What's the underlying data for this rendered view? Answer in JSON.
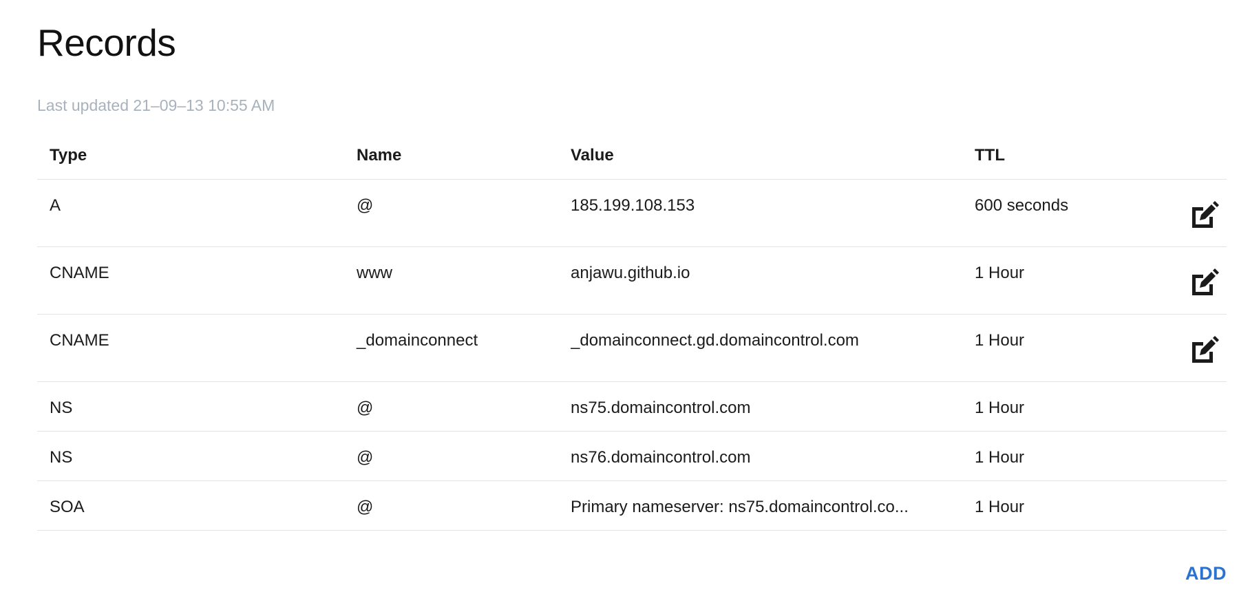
{
  "header": {
    "title": "Records",
    "last_updated": "Last updated 21–09–13 10:55 AM"
  },
  "table": {
    "columns": [
      "Type",
      "Name",
      "Value",
      "TTL"
    ],
    "rows": [
      {
        "type": "A",
        "name": "@",
        "value": "185.199.108.153",
        "ttl": "600 seconds",
        "editable": true
      },
      {
        "type": "CNAME",
        "name": "www",
        "value": "anjawu.github.io",
        "ttl": "1 Hour",
        "editable": true
      },
      {
        "type": "CNAME",
        "name": "_domainconnect",
        "value": "_domainconnect.gd.domaincontrol.com",
        "ttl": "1 Hour",
        "editable": true
      },
      {
        "type": "NS",
        "name": "@",
        "value": "ns75.domaincontrol.com",
        "ttl": "1 Hour",
        "editable": false
      },
      {
        "type": "NS",
        "name": "@",
        "value": "ns76.domaincontrol.com",
        "ttl": "1 Hour",
        "editable": false
      },
      {
        "type": "SOA",
        "name": "@",
        "value": "Primary nameserver: ns75.domaincontrol.co...",
        "ttl": "1 Hour",
        "editable": false
      }
    ]
  },
  "actions": {
    "add_label": "ADD",
    "edit_icon": "edit-icon"
  },
  "colors": {
    "accent": "#2b73d0",
    "muted_text": "#a7b2bd",
    "divider": "#e3e3e3",
    "text": "#1b1b1b"
  }
}
